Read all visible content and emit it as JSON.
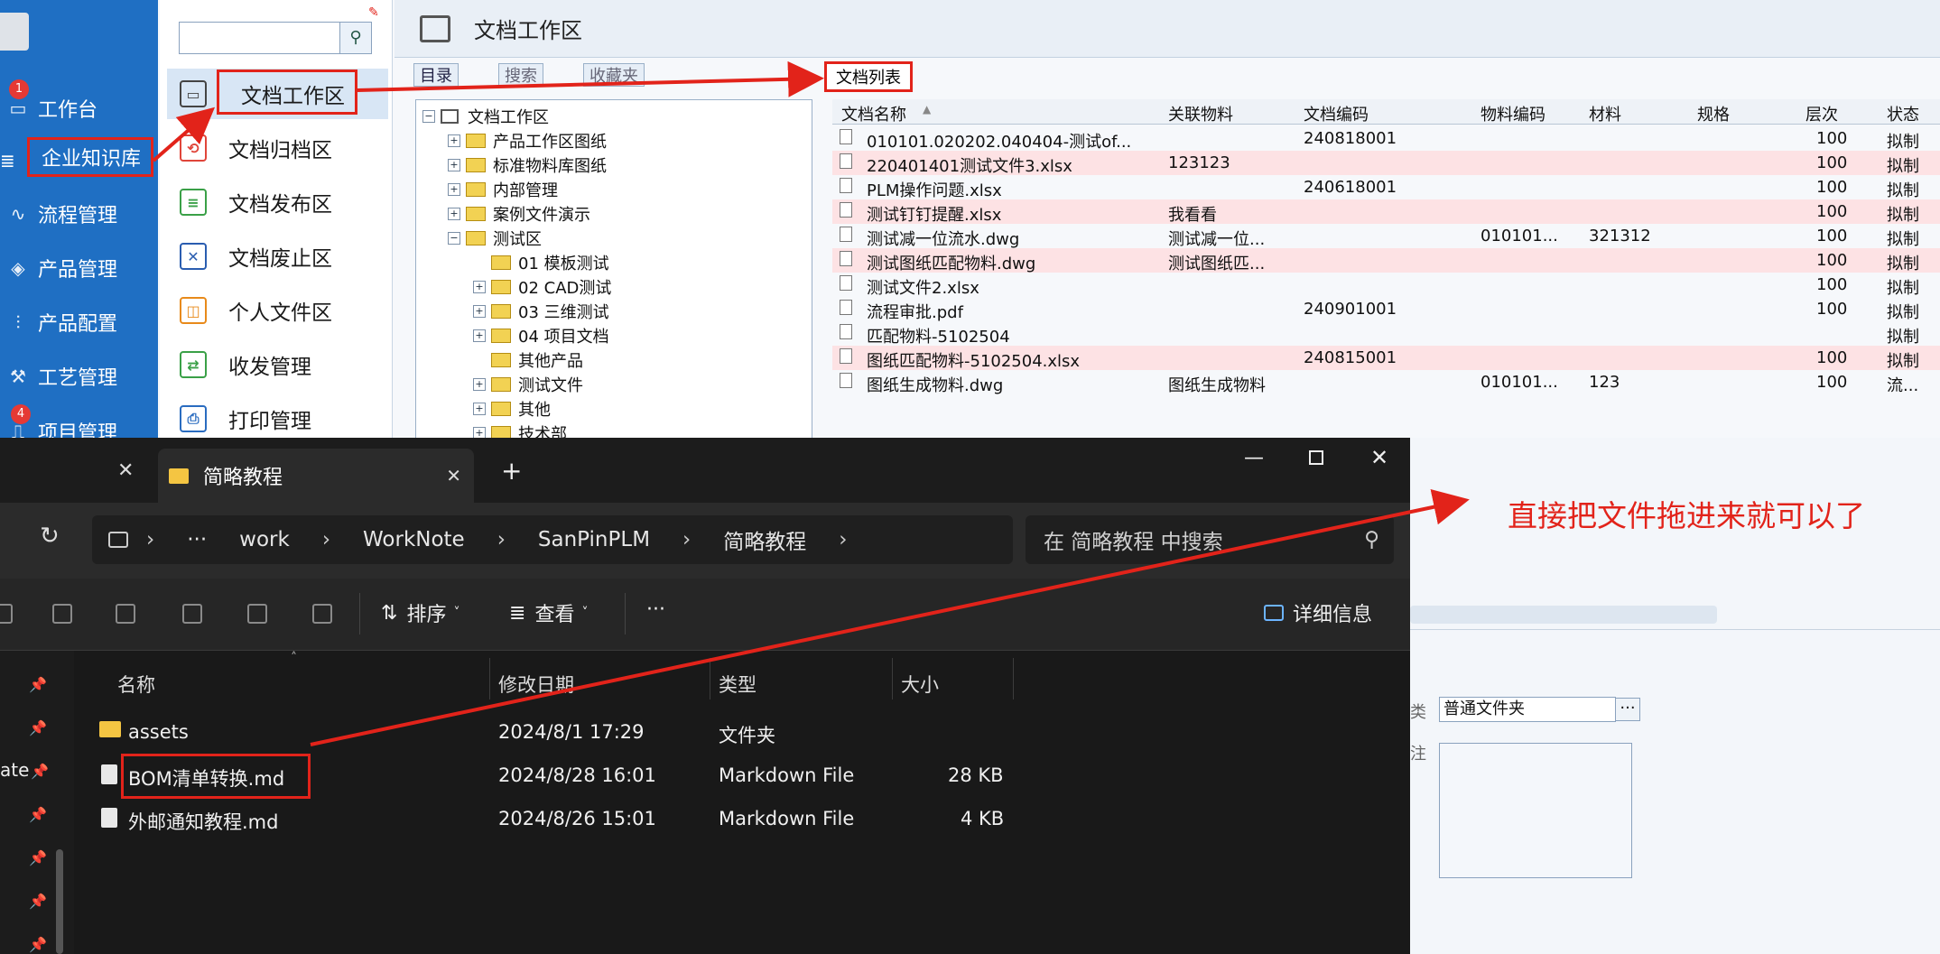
{
  "nav": {
    "items": [
      {
        "label": "工作台",
        "badge": "1"
      },
      {
        "label": "企业知识库"
      },
      {
        "label": "流程管理"
      },
      {
        "label": "产品管理"
      },
      {
        "label": "产品配置"
      },
      {
        "label": "工艺管理"
      },
      {
        "label": "项目管理",
        "badge": "4"
      }
    ]
  },
  "col2": {
    "search_placeholder": "",
    "items": [
      {
        "label": "文档工作区"
      },
      {
        "label": "文档归档区"
      },
      {
        "label": "文档发布区"
      },
      {
        "label": "文档废止区"
      },
      {
        "label": "个人文件区"
      },
      {
        "label": "收发管理"
      },
      {
        "label": "打印管理"
      }
    ]
  },
  "header": {
    "title": "文档工作区"
  },
  "tree": {
    "tabs": [
      "目录",
      "搜索",
      "收藏夹"
    ],
    "root": "文档工作区",
    "nodes": [
      "产品工作区图纸",
      "标准物料库图纸",
      "内部管理",
      "案例文件演示",
      "测试区"
    ],
    "children": [
      "01 模板测试",
      "02 CAD测试",
      "03 三维测试",
      "04 项目文档",
      "其他产品",
      "测试文件",
      "其他",
      "技术部"
    ]
  },
  "list": {
    "tab": "文档列表",
    "columns": [
      "文档名称",
      "关联物料",
      "文档编码",
      "物料编码",
      "材料",
      "规格",
      "层次",
      "状态"
    ],
    "rows": [
      [
        "010101.020202.040404-测试of...",
        "",
        "240818001",
        "",
        "",
        "",
        "100",
        "拟制"
      ],
      [
        "220401401测试文件3.xlsx",
        "123123",
        "",
        "",
        "",
        "",
        "100",
        "拟制"
      ],
      [
        "PLM操作问题.xlsx",
        "",
        "240618001",
        "",
        "",
        "",
        "100",
        "拟制"
      ],
      [
        "测试钉钉提醒.xlsx",
        "我看看",
        "",
        "",
        "",
        "",
        "100",
        "拟制"
      ],
      [
        "测试减一位流水.dwg",
        "测试减一位...",
        "",
        "010101...",
        "321312",
        "",
        "100",
        "拟制"
      ],
      [
        "测试图纸匹配物料.dwg",
        "测试图纸匹...",
        "",
        "",
        "",
        "",
        "100",
        "拟制"
      ],
      [
        "测试文件2.xlsx",
        "",
        "",
        "",
        "",
        "",
        "100",
        "拟制"
      ],
      [
        "流程审批.pdf",
        "",
        "240901001",
        "",
        "",
        "",
        "100",
        "拟制"
      ],
      [
        "匹配物料-5102504",
        "",
        "",
        "",
        "",
        "",
        "",
        "拟制"
      ],
      [
        "图纸匹配物料-5102504.xlsx",
        "",
        "240815001",
        "",
        "",
        "",
        "100",
        "拟制"
      ],
      [
        "图纸生成物料.dwg",
        "图纸生成物料",
        "",
        "010101...",
        "123",
        "",
        "100",
        "流..."
      ]
    ]
  },
  "explorer": {
    "tab_title": "简略教程",
    "add_tab": "+",
    "path": [
      "work",
      "WorkNote",
      "SanPinPLM",
      "简略教程"
    ],
    "search_placeholder": "在 简略教程 中搜索",
    "toolbar": {
      "sort": "排序",
      "view": "查看",
      "more": "···",
      "details": "详细信息"
    },
    "columns": [
      "名称",
      "修改日期",
      "类型",
      "大小"
    ],
    "files": [
      {
        "name": "assets",
        "date": "2024/8/1 17:29",
        "type": "文件夹",
        "size": ""
      },
      {
        "name": "BOM清单转换.md",
        "date": "2024/8/28 16:01",
        "type": "Markdown File",
        "size": "28 KB"
      },
      {
        "name": "外邮通知教程.md",
        "date": "2024/8/26 15:01",
        "type": "Markdown File",
        "size": "4 KB"
      }
    ],
    "side_text": "ate"
  },
  "right_lower": {
    "category_label": "类",
    "category_value": "普通文件夹",
    "remark_label": "注"
  },
  "annotation": "直接把文件拖进来就可以了"
}
